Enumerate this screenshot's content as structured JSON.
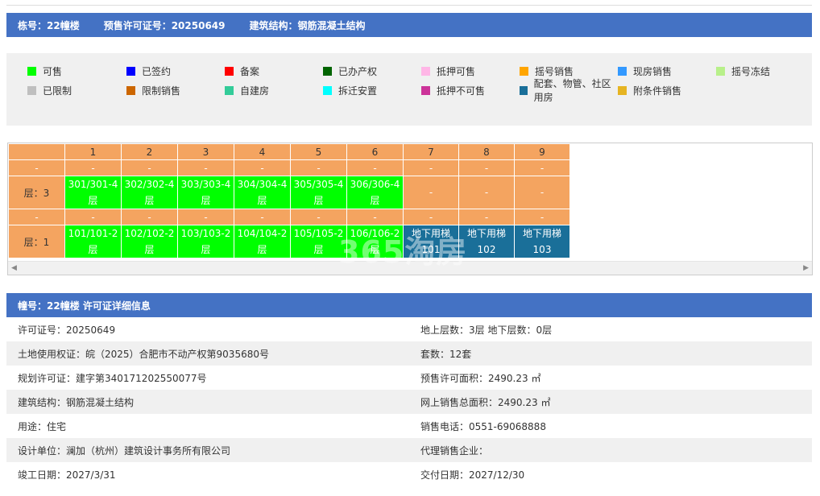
{
  "header": {
    "building": "栋号：22幢楼",
    "permit": "预售许可证号：20250649",
    "structure": "建筑结构：钢筋混凝土结构"
  },
  "legend": [
    [
      {
        "label": "可售",
        "color": "#00ff00"
      },
      {
        "label": "已签约",
        "color": "#0000ff"
      },
      {
        "label": "备案",
        "color": "#ff0000"
      },
      {
        "label": "已办产权",
        "color": "#006400"
      },
      {
        "label": "抵押可售",
        "color": "#ffb6e6"
      },
      {
        "label": "摇号销售",
        "color": "#ffa500"
      },
      {
        "label": "现房销售",
        "color": "#3399ff"
      },
      {
        "label": "摇号冻结",
        "color": "#b8f08a"
      }
    ],
    [
      {
        "label": "已限制",
        "color": "#bfbfbf"
      },
      {
        "label": "限制销售",
        "color": "#cc6600"
      },
      {
        "label": "自建房",
        "color": "#33cc99"
      },
      {
        "label": "拆迁安置",
        "color": "#00ffff"
      },
      {
        "label": "抵押不可售",
        "color": "#cc3399"
      },
      {
        "label": "配套、物管、社区用房",
        "color": "#1a6f99"
      },
      {
        "label": "附条件销售",
        "color": "#e6b422"
      }
    ]
  ],
  "grid": {
    "columns": [
      "1",
      "2",
      "3",
      "4",
      "5",
      "6",
      "7",
      "8",
      "9"
    ],
    "dash": "-",
    "floor3_label": "层：3",
    "floor1_label": "层：1",
    "floor3": [
      {
        "text": "301/301-4层",
        "status": "green"
      },
      {
        "text": "302/302-4层",
        "status": "green"
      },
      {
        "text": "303/303-4层",
        "status": "green"
      },
      {
        "text": "304/304-4层",
        "status": "green"
      },
      {
        "text": "305/305-4层",
        "status": "green"
      },
      {
        "text": "306/306-4层",
        "status": "green"
      },
      {
        "text": "-",
        "status": "orange"
      },
      {
        "text": "-",
        "status": "orange"
      },
      {
        "text": "-",
        "status": "orange"
      }
    ],
    "floor1": [
      {
        "text": "101/101-2层",
        "status": "green"
      },
      {
        "text": "102/102-2层",
        "status": "green"
      },
      {
        "text": "103/103-2层",
        "status": "green"
      },
      {
        "text": "104/104-2层",
        "status": "green"
      },
      {
        "text": "105/105-2层",
        "status": "green"
      },
      {
        "text": "106/106-2层",
        "status": "green"
      },
      {
        "text": "地下用梯101",
        "status": "teal"
      },
      {
        "text": "地下用梯102",
        "status": "teal"
      },
      {
        "text": "地下用梯103",
        "status": "teal"
      }
    ],
    "watermark": "365淘房"
  },
  "info": {
    "title": "幢号：22幢楼 许可证详细信息",
    "rows": [
      [
        "许可证号：20250649",
        "地上层数：3层  地下层数：0层"
      ],
      [
        "土地使用权证：皖（2025）合肥市不动产权第9035680号",
        "套数：12套"
      ],
      [
        "规划许可证：建字第340171202550077号",
        "预售许可面积：2490.23 ㎡"
      ],
      [
        "建筑结构：钢筋混凝土结构",
        "网上销售总面积：2490.23 ㎡"
      ],
      [
        "用途：住宅",
        "销售电话：0551-69068888"
      ],
      [
        "设计单位：澜加（杭州）建筑设计事务所有限公司",
        "代理销售企业："
      ],
      [
        "竣工日期：2027/3/31",
        "交付日期：2027/12/30"
      ]
    ]
  }
}
